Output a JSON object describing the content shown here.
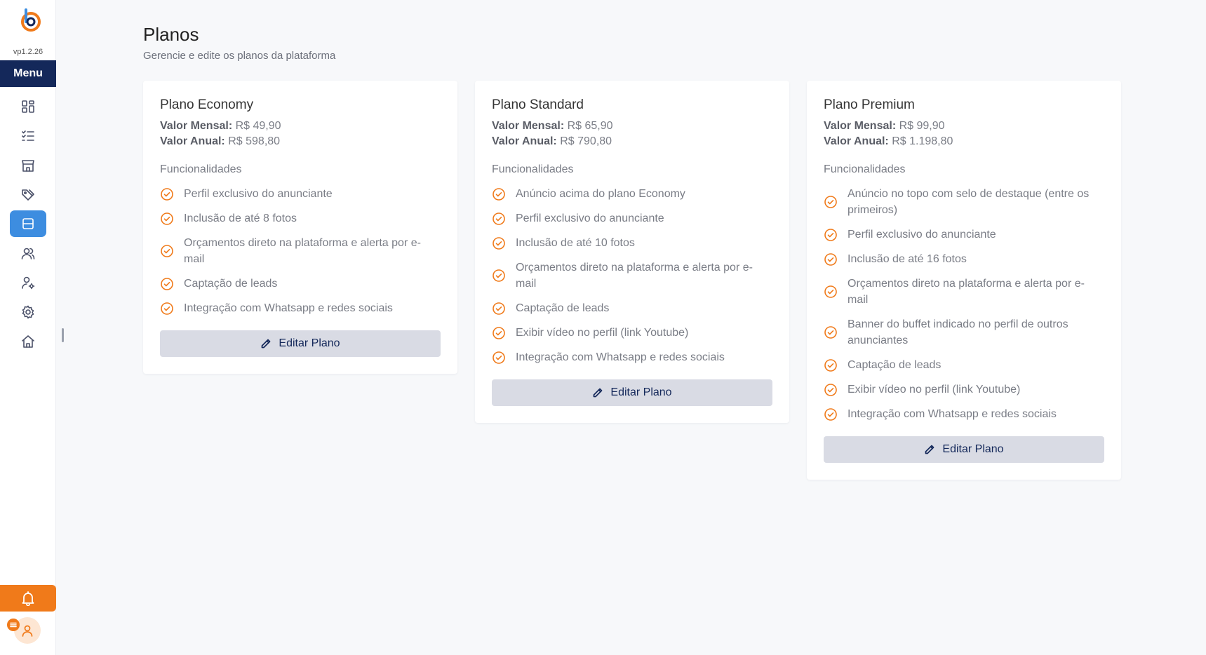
{
  "app": {
    "version": "vp1.2.26",
    "menu_label": "Menu"
  },
  "sidebar": {
    "items": [
      {
        "icon": "dashboard-icon"
      },
      {
        "icon": "checklist-icon"
      },
      {
        "icon": "store-icon"
      },
      {
        "icon": "tags-icon"
      },
      {
        "icon": "plans-icon",
        "active": true
      },
      {
        "icon": "users-icon"
      },
      {
        "icon": "user-settings-icon"
      },
      {
        "icon": "gear-icon"
      },
      {
        "icon": "home-icon"
      }
    ],
    "notifications_icon": "bell-icon",
    "profile_icon": "user-icon"
  },
  "page": {
    "title": "Planos",
    "subtitle": "Gerencie e edite os planos da plataforma"
  },
  "labels": {
    "monthly": "Valor Mensal:",
    "annual": "Valor Anual:",
    "features": "Funcionalidades",
    "edit_button": "Editar Plano"
  },
  "plans": [
    {
      "name": "Plano Economy",
      "monthly": "R$ 49,90",
      "annual": "R$ 598,80",
      "features": [
        "Perfil exclusivo do anunciante",
        "Inclusão de até 8 fotos",
        "Orçamentos direto na plataforma e alerta por e-mail",
        "Captação de leads",
        "Integração com Whatsapp e redes sociais"
      ]
    },
    {
      "name": "Plano Standard",
      "monthly": "R$ 65,90",
      "annual": "R$ 790,80",
      "features": [
        "Anúncio acima do plano Economy",
        "Perfil exclusivo do anunciante",
        "Inclusão de até 10 fotos",
        "Orçamentos direto na plataforma e alerta por e-mail",
        "Captação de leads",
        "Exibir vídeo no perfil (link Youtube)",
        "Integração com Whatsapp e redes sociais"
      ]
    },
    {
      "name": "Plano Premium",
      "monthly": "R$ 99,90",
      "annual": "R$ 1.198,80",
      "features": [
        "Anúncio no topo com selo de destaque (entre os primeiros)",
        "Perfil exclusivo do anunciante",
        "Inclusão de até 16 fotos",
        "Orçamentos direto na plataforma e alerta por e-mail",
        "Banner do buffet indicado no perfil de outros anunciantes",
        "Captação de leads",
        "Exibir vídeo no perfil (link Youtube)",
        "Integração com Whatsapp e redes sociais"
      ]
    }
  ],
  "colors": {
    "accent_orange": "#f07a1a",
    "navy": "#14285a",
    "active_blue": "#3d8de0"
  }
}
